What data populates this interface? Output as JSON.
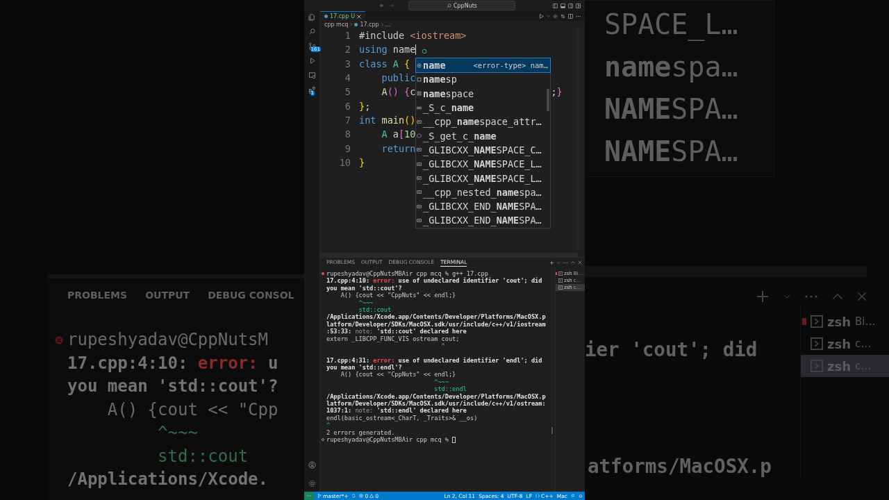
{
  "backdrop_left": {
    "panel_tabs": [
      "PROBLEMS",
      "OUTPUT",
      "DEBUG CONSOL"
    ],
    "lines": [
      {
        "kind": "error-prompt",
        "segments": [
          {
            "text": "rupeshyadav@CppNutsM",
            "kind": "plain"
          }
        ]
      },
      {
        "kind": "output",
        "segments": [
          {
            "text": "17.cpp:4:10: ",
            "kind": "bold"
          },
          {
            "text": "error:",
            "kind": "error"
          },
          {
            "text": " u",
            "kind": "bold"
          }
        ]
      },
      {
        "kind": "output",
        "segments": [
          {
            "text": "you mean 'std::cout'?",
            "kind": "bold"
          }
        ]
      },
      {
        "kind": "output",
        "segments": [
          {
            "text": "    A() {cout << \"Cpp",
            "kind": "plain"
          }
        ]
      },
      {
        "kind": "output",
        "segments": [
          {
            "text": "         ^~~~",
            "kind": "green"
          }
        ]
      },
      {
        "kind": "output",
        "segments": [
          {
            "text": "         std::cout",
            "kind": "green"
          }
        ]
      },
      {
        "kind": "output",
        "segments": [
          {
            "text": "/Applications/Xcode.",
            "kind": "bold"
          }
        ]
      }
    ]
  },
  "backdrop_right": {
    "suggestions": [
      "SPACE_L…",
      "**name**spa…",
      "**NAME**SPA…",
      "**NAME**SPA…"
    ],
    "lines": [
      "ier 'cout'; did",
      "atforms/MacOSX.p"
    ],
    "terminals": [
      {
        "label": "zsh",
        "detail": "Bi…",
        "kind": "error",
        "selected": false
      },
      {
        "label": "zsh",
        "detail": "c…",
        "kind": "plain",
        "selected": false
      },
      {
        "label": "zsh",
        "detail": "c…",
        "kind": "plain",
        "selected": true
      }
    ]
  },
  "window": {
    "search": "CppNuts"
  },
  "activity_bar": [
    {
      "kind": "explorer"
    },
    {
      "kind": "search"
    },
    {
      "kind": "source-control",
      "badge": "161"
    },
    {
      "kind": "run"
    },
    {
      "kind": "remote"
    },
    {
      "kind": "extensions",
      "badge": "1"
    }
  ],
  "editor_tab": {
    "label": "17.cpp",
    "status": "U"
  },
  "breadcrumb": [
    "cpp mcq",
    "17.cpp",
    "..."
  ],
  "code_lines": [
    {
      "number": "1",
      "cursor": false,
      "tokens": [
        {
          "text": "#include",
          "kind": "directive"
        },
        {
          "text": " <iostream>",
          "kind": "string"
        }
      ]
    },
    {
      "number": "2",
      "cursor": true,
      "tokens": [
        {
          "text": "using",
          "kind": "keyword"
        },
        {
          "text": " name",
          "kind": "plain"
        }
      ]
    },
    {
      "number": "3",
      "cursor": false,
      "tokens": [
        {
          "text": "class",
          "kind": "keyword"
        },
        {
          "text": " A",
          "kind": "type"
        },
        {
          "text": " {",
          "kind": "bracket1"
        }
      ]
    },
    {
      "number": "4",
      "cursor": false,
      "tokens": [
        {
          "text": "    public",
          "kind": "keyword"
        }
      ]
    },
    {
      "number": "5",
      "cursor": false,
      "tokens": [
        {
          "text": "    A",
          "kind": "func"
        },
        {
          "text": "()",
          "kind": "bracket2"
        },
        {
          "text": " {",
          "kind": "bracket2"
        },
        {
          "text": "c",
          "kind": "plain"
        }
      ],
      "tail": [
        {
          "text": ";",
          "kind": "plain"
        },
        {
          "text": "}",
          "kind": "bracket2"
        }
      ]
    },
    {
      "number": "6",
      "cursor": false,
      "tokens": [
        {
          "text": "}",
          "kind": "bracket1"
        },
        {
          "text": ";",
          "kind": "plain"
        }
      ]
    },
    {
      "number": "7",
      "cursor": false,
      "tokens": [
        {
          "text": "int",
          "kind": "keyword"
        },
        {
          "text": " main",
          "kind": "func"
        },
        {
          "text": "()",
          "kind": "bracket1"
        }
      ]
    },
    {
      "number": "8",
      "cursor": false,
      "tokens": [
        {
          "text": "    A",
          "kind": "type"
        },
        {
          "text": " a",
          "kind": "plain"
        },
        {
          "text": "[",
          "kind": "bracket2"
        },
        {
          "text": "10",
          "kind": "number"
        }
      ]
    },
    {
      "number": "9",
      "cursor": false,
      "tokens": [
        {
          "text": "    return",
          "kind": "keyword"
        }
      ]
    },
    {
      "number": "10",
      "cursor": false,
      "tokens": [
        {
          "text": "}",
          "kind": "bracket1"
        }
      ]
    }
  ],
  "suggestions": [
    {
      "kind": "variable",
      "label": "**name**",
      "detail": "<error-type> nam…",
      "selected": true
    },
    {
      "kind": "keyword",
      "label": "**name**sp",
      "selected": false
    },
    {
      "kind": "snippet",
      "label": "**name**space",
      "selected": false
    },
    {
      "kind": "struct",
      "label": "_S_c_**name**",
      "selected": false
    },
    {
      "kind": "macro",
      "label": "__cpp_**name**space_attr…",
      "selected": false
    },
    {
      "kind": "method",
      "label": "_S_get_c_**name**",
      "selected": false
    },
    {
      "kind": "macro",
      "label": "_GLIBCXX_**NAME**SPACE_C…",
      "selected": false
    },
    {
      "kind": "macro",
      "label": "_GLIBCXX_**NAME**SPACE_L…",
      "selected": false
    },
    {
      "kind": "macro",
      "label": "_GLIBCXX_**NAME**SPACE_L…",
      "selected": false
    },
    {
      "kind": "macro",
      "label": "__cpp_nested_**name**spa…",
      "selected": false
    },
    {
      "kind": "macro",
      "label": "_GLIBCXX_END_**NAME**SPA…",
      "selected": false
    },
    {
      "kind": "macro",
      "label": "_GLIBCXX_END_**NAME**SPA…",
      "selected": false
    }
  ],
  "panel": {
    "tabs": [
      {
        "label": "PROBLEMS",
        "selected": false
      },
      {
        "label": "OUTPUT",
        "selected": false
      },
      {
        "label": "DEBUG CONSOLE",
        "selected": false
      },
      {
        "label": "TERMINAL",
        "selected": true
      }
    ],
    "terminal_lines": [
      {
        "kind": "error-prompt",
        "segments": [
          {
            "text": "rupeshyadav@CppNutsMBAir cpp mcq % g++ 17.cpp",
            "kind": "plain"
          }
        ]
      },
      {
        "kind": "output",
        "segments": [
          {
            "text": "17.cpp:4:10: ",
            "kind": "bold"
          },
          {
            "text": "error:",
            "kind": "error"
          },
          {
            "text": " use of undeclared identifier 'cout'; did",
            "kind": "bold"
          }
        ]
      },
      {
        "kind": "output",
        "segments": [
          {
            "text": "you mean 'std::cout'?",
            "kind": "bold"
          }
        ]
      },
      {
        "kind": "output",
        "segments": [
          {
            "text": "    A() {cout << \"CppNuts\" << endl;}",
            "kind": "plain"
          }
        ]
      },
      {
        "kind": "output",
        "segments": [
          {
            "text": "         ^~~~",
            "kind": "green"
          }
        ]
      },
      {
        "kind": "output",
        "segments": [
          {
            "text": "         std::cout",
            "kind": "green"
          }
        ]
      },
      {
        "kind": "output",
        "segments": [
          {
            "text": "/Applications/Xcode.app/Contents/Developer/Platforms/MacOSX.p",
            "kind": "bold"
          }
        ]
      },
      {
        "kind": "output",
        "segments": [
          {
            "text": "latform/Developer/SDKs/MacOSX.sdk/usr/include/c++/v1/iostream",
            "kind": "bold"
          }
        ]
      },
      {
        "kind": "output",
        "segments": [
          {
            "text": ":53:33:",
            "kind": "bold"
          },
          {
            "text": " note:",
            "kind": "note"
          },
          {
            "text": " 'std::cout' declared here",
            "kind": "bold"
          }
        ]
      },
      {
        "kind": "output",
        "segments": [
          {
            "text": "extern _LIBCPP_FUNC_VIS ostream cout;",
            "kind": "plain"
          }
        ]
      },
      {
        "kind": "output",
        "segments": [
          {
            "text": "                                ^",
            "kind": "green"
          }
        ]
      },
      {
        "kind": "blank"
      },
      {
        "kind": "output",
        "segments": [
          {
            "text": "17.cpp:4:31: ",
            "kind": "bold"
          },
          {
            "text": "error:",
            "kind": "error"
          },
          {
            "text": " use of undeclared identifier 'endl'; did",
            "kind": "bold"
          }
        ]
      },
      {
        "kind": "output",
        "segments": [
          {
            "text": "you mean 'std::endl'?",
            "kind": "bold"
          }
        ]
      },
      {
        "kind": "output",
        "segments": [
          {
            "text": "    A() {cout << \"CppNuts\" << endl;}",
            "kind": "plain"
          }
        ]
      },
      {
        "kind": "output",
        "segments": [
          {
            "text": "                              ^~~~",
            "kind": "green"
          }
        ]
      },
      {
        "kind": "output",
        "segments": [
          {
            "text": "                              std::endl",
            "kind": "green"
          }
        ]
      },
      {
        "kind": "output",
        "segments": [
          {
            "text": "/Applications/Xcode.app/Contents/Developer/Platforms/MacOSX.p",
            "kind": "bold"
          }
        ]
      },
      {
        "kind": "output",
        "segments": [
          {
            "text": "latform/Developer/SDKs/MacOSX.sdk/usr/include/c++/v1/ostream:",
            "kind": "bold"
          }
        ]
      },
      {
        "kind": "output",
        "segments": [
          {
            "text": "1037:1:",
            "kind": "bold"
          },
          {
            "text": " note:",
            "kind": "note"
          },
          {
            "text": " 'std::endl' declared here",
            "kind": "bold"
          }
        ]
      },
      {
        "kind": "output",
        "segments": [
          {
            "text": "endl(basic_ostream<_CharT, _Traits>& __os)",
            "kind": "plain"
          }
        ]
      },
      {
        "kind": "output",
        "segments": [
          {
            "text": "^",
            "kind": "green"
          }
        ]
      },
      {
        "kind": "output",
        "segments": [
          {
            "text": "2 errors generated.",
            "kind": "plain"
          }
        ]
      },
      {
        "kind": "prompt",
        "segments": [
          {
            "text": "rupeshyadav@CppNutsMBAir cpp mcq %",
            "kind": "plain"
          }
        ]
      }
    ],
    "cursor_visible": true,
    "terminals": [
      {
        "label": "zsh",
        "detail": "Bi…",
        "kind": "error",
        "selected": false
      },
      {
        "label": "zsh",
        "detail": "c…",
        "kind": "plain",
        "selected": false
      },
      {
        "label": "zsh",
        "detail": "c…",
        "kind": "plain",
        "selected": true
      }
    ]
  },
  "status_bar": {
    "branch": "master*+",
    "errors": "0",
    "warnings": "0",
    "items": [
      "Ln 2, Col 11",
      "Spaces: 4",
      "UTF-8",
      "LF"
    ],
    "language": "C++",
    "eol_mode": "Mac"
  }
}
